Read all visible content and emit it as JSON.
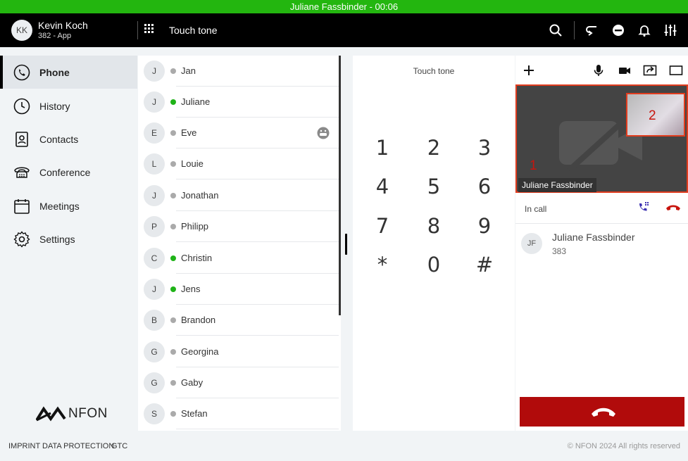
{
  "call_bar": {
    "text": "Juliane Fassbinder - 00:06"
  },
  "user": {
    "initials": "KK",
    "name": "Kevin Koch",
    "extension": "382 - App"
  },
  "header": {
    "title": "Touch tone"
  },
  "sidebar": {
    "items": [
      {
        "label": "Phone",
        "icon": "phone-icon",
        "active": true
      },
      {
        "label": "History",
        "icon": "clock-icon"
      },
      {
        "label": "Contacts",
        "icon": "contact-card-icon"
      },
      {
        "label": "Conference",
        "icon": "conference-phone-icon"
      },
      {
        "label": "Meetings",
        "icon": "calendar-icon"
      },
      {
        "label": "Settings",
        "icon": "gear-icon"
      }
    ],
    "logo": "NFON"
  },
  "contacts": [
    {
      "initial": "J",
      "name": "Jan",
      "status": "offline"
    },
    {
      "initial": "J",
      "name": "Juliane",
      "status": "online"
    },
    {
      "initial": "E",
      "name": "Eve",
      "status": "offline",
      "icon": "emoji-icon"
    },
    {
      "initial": "L",
      "name": "Louie",
      "status": "offline"
    },
    {
      "initial": "J",
      "name": "Jonathan",
      "status": "offline"
    },
    {
      "initial": "P",
      "name": "Philipp",
      "status": "offline"
    },
    {
      "initial": "C",
      "name": "Christin",
      "status": "online"
    },
    {
      "initial": "J",
      "name": "Jens",
      "status": "online"
    },
    {
      "initial": "B",
      "name": "Brandon",
      "status": "offline"
    },
    {
      "initial": "G",
      "name": "Georgina",
      "status": "offline"
    },
    {
      "initial": "G",
      "name": "Gaby",
      "status": "offline"
    },
    {
      "initial": "S",
      "name": "Stefan",
      "status": "offline"
    }
  ],
  "dialpad": {
    "title": "Touch tone",
    "keys": [
      "1",
      "2",
      "3",
      "4",
      "5",
      "6",
      "7",
      "8",
      "9",
      "*",
      "0",
      "#"
    ]
  },
  "call_panel": {
    "video_label": "Juliane Fassbinder",
    "marker_main": "1",
    "marker_pip": "2",
    "status": "In call",
    "peer": {
      "initials": "JF",
      "name": "Juliane Fassbinder",
      "extension": "383"
    }
  },
  "footer": {
    "links": [
      "IMPRINT",
      "DATA PROTECTION",
      "GTC"
    ],
    "copyright": "© NFON 2024 All rights reserved"
  },
  "colors": {
    "online": "#1fb318",
    "call_bar": "#23b60f",
    "hangup": "#b10b0b",
    "highlight": "#e13c1e",
    "accent": "#3a2fb0"
  }
}
